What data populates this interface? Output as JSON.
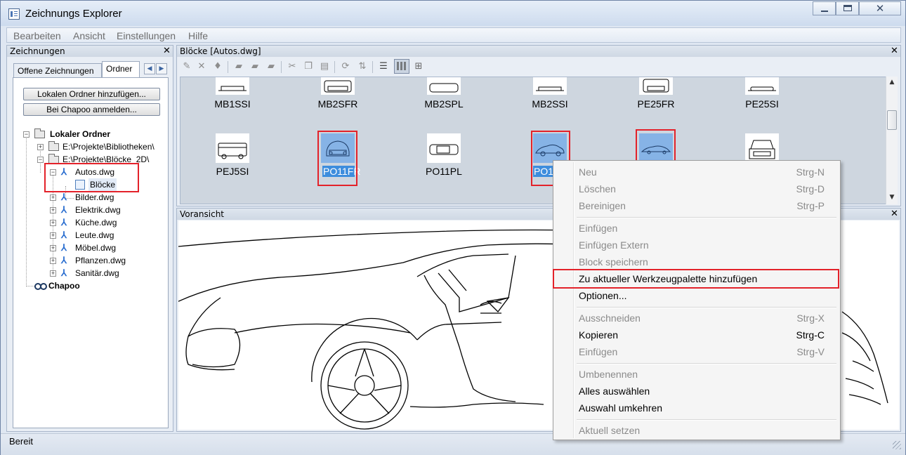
{
  "window": {
    "title": "Zeichnungs Explorer"
  },
  "menubar": {
    "items": [
      "Bearbeiten",
      "Ansicht",
      "Einstellungen",
      "Hilfe"
    ]
  },
  "left_pane": {
    "title": "Zeichnungen",
    "tabs": [
      "Offene Zeichnungen",
      "Ordner"
    ],
    "active_tab": "Ordner",
    "buttons": {
      "add_local_folder": "Lokalen Ordner hinzufügen...",
      "chapoo_login": "Bei Chapoo anmelden..."
    },
    "tree": {
      "local_folder": "Lokaler Ordner",
      "paths": [
        "E:\\Projekte\\Bibliotheken\\",
        "E:\\Projekte\\Blöcke_2D\\"
      ],
      "files": [
        "Autos.dwg",
        "Bilder.dwg",
        "Elektrik.dwg",
        "Küche.dwg",
        "Leute.dwg",
        "Möbel.dwg",
        "Pflanzen.dwg",
        "Sanitär.dwg"
      ],
      "blocks_node": "Blöcke",
      "chapoo": "Chapoo"
    }
  },
  "blocks_pane": {
    "title": "Blöcke [Autos.dwg]",
    "row1": [
      "MB1SSI",
      "MB2SFR",
      "MB2SPL",
      "MB2SSI",
      "PE25FR",
      "PE25SI"
    ],
    "row2": [
      "PEJ5SI",
      "PO11FR",
      "PO11PL",
      "PO1"
    ]
  },
  "preview_pane": {
    "title": "Voransicht"
  },
  "status": {
    "text": "Bereit"
  },
  "context_menu": {
    "items": [
      {
        "label": "Neu",
        "shortcut": "Strg-N",
        "enabled": false
      },
      {
        "label": "Löschen",
        "shortcut": "Strg-D",
        "enabled": false
      },
      {
        "label": "Bereinigen",
        "shortcut": "Strg-P",
        "enabled": false
      },
      {
        "label": "Einfügen",
        "shortcut": "",
        "enabled": false
      },
      {
        "label": "Einfügen Extern",
        "shortcut": "",
        "enabled": false
      },
      {
        "label": "Block speichern",
        "shortcut": "",
        "enabled": false
      },
      {
        "label": "Zu aktueller Werkzeugpalette hinzufügen",
        "shortcut": "",
        "enabled": true
      },
      {
        "label": "Optionen...",
        "shortcut": "",
        "enabled": true
      },
      {
        "label": "Ausschneiden",
        "shortcut": "Strg-X",
        "enabled": false
      },
      {
        "label": "Kopieren",
        "shortcut": "Strg-C",
        "enabled": true
      },
      {
        "label": "Einfügen",
        "shortcut": "Strg-V",
        "enabled": false
      },
      {
        "label": "Umbenennen",
        "shortcut": "",
        "enabled": false
      },
      {
        "label": "Alles auswählen",
        "shortcut": "",
        "enabled": true
      },
      {
        "label": "Auswahl umkehren",
        "shortcut": "",
        "enabled": true
      },
      {
        "label": "Aktuell setzen",
        "shortcut": "",
        "enabled": false
      }
    ]
  },
  "colors": {
    "selection": "#3d8ddd",
    "highlight_box": "#e3222a",
    "disabled_text": "#8a8a8a"
  }
}
